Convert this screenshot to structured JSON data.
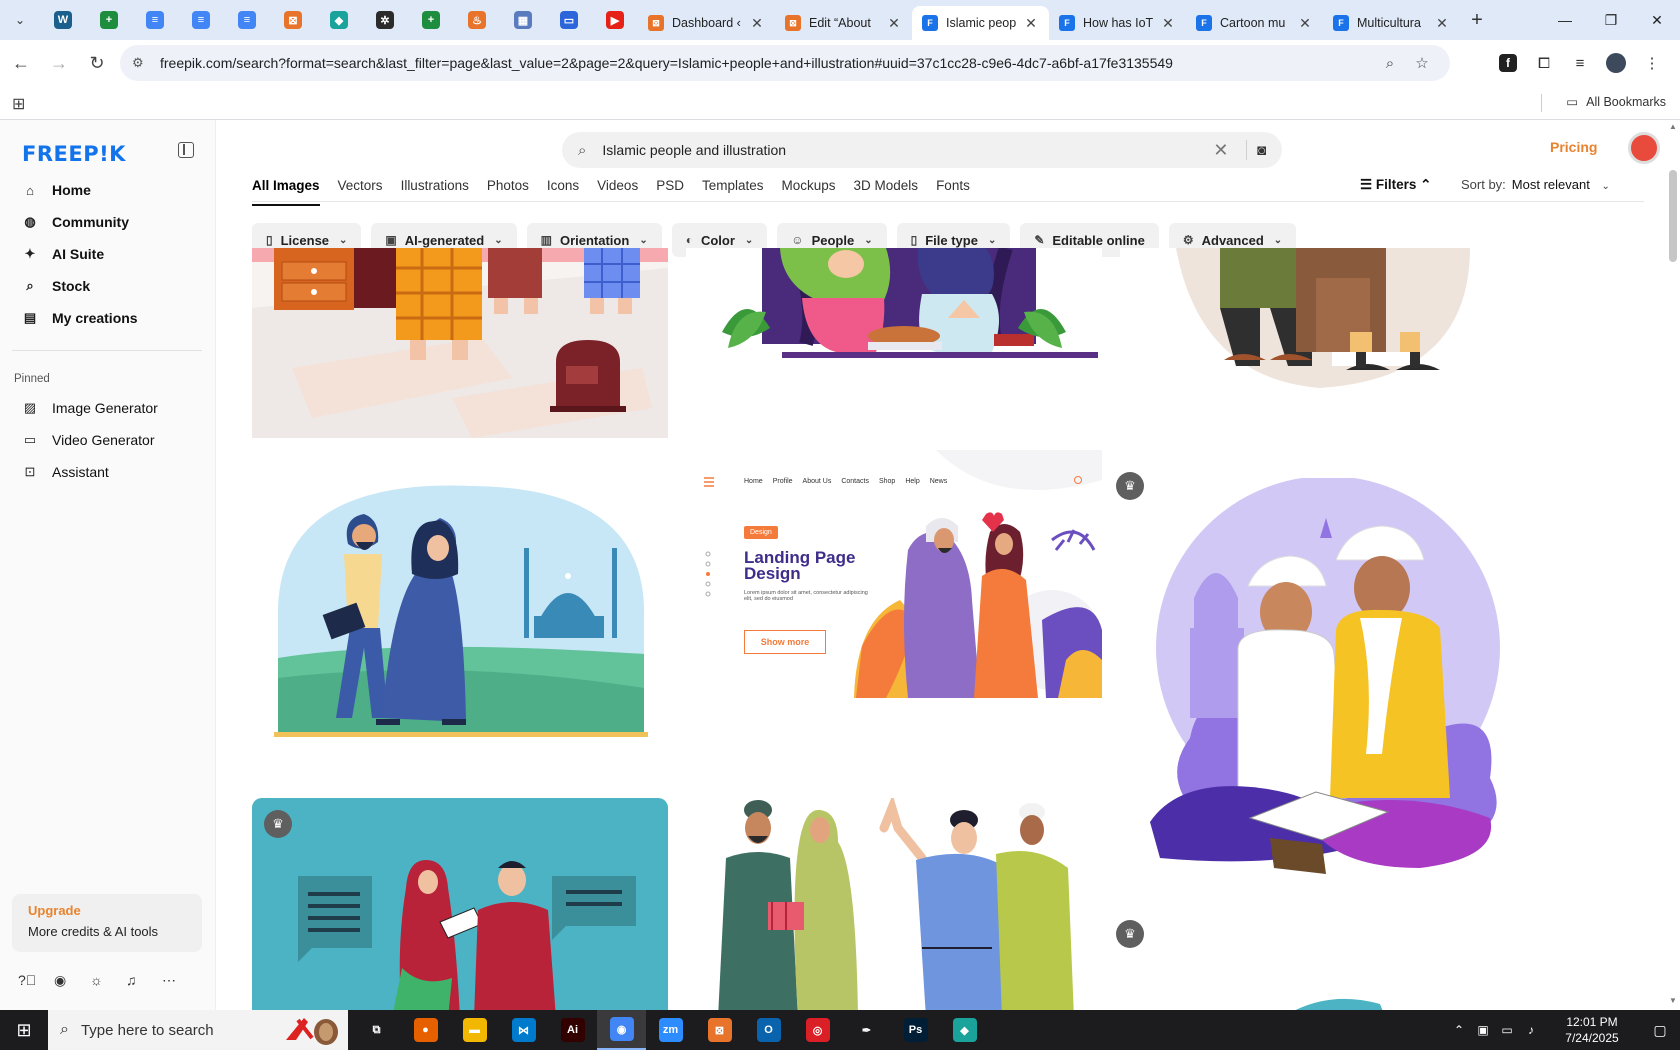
{
  "browser": {
    "pinned_tabs": [
      {
        "icon": "wordpress-icon",
        "color": "#1b5f8c",
        "glyph": "W"
      },
      {
        "icon": "sheets-icon",
        "color": "#1e8e3e",
        "glyph": "+"
      },
      {
        "icon": "docs-icon",
        "color": "#4285f4",
        "glyph": "≡"
      },
      {
        "icon": "docs-icon",
        "color": "#4285f4",
        "glyph": "≡"
      },
      {
        "icon": "docs-icon",
        "color": "#4285f4",
        "glyph": "≡"
      },
      {
        "icon": "xampp-icon",
        "color": "#e8742c",
        "glyph": "⊠"
      },
      {
        "icon": "app-icon",
        "color": "#1aa39a",
        "glyph": "◆"
      },
      {
        "icon": "chatgpt-icon",
        "color": "#2b2b2b",
        "glyph": "✲"
      },
      {
        "icon": "sheets-icon",
        "color": "#1e8e3e",
        "glyph": "+"
      },
      {
        "icon": "site-icon",
        "color": "#e8742c",
        "glyph": "♨"
      },
      {
        "icon": "app-icon",
        "color": "#5a7bbd",
        "glyph": "▦"
      },
      {
        "icon": "forms-icon",
        "color": "#2b65d9",
        "glyph": "▭"
      },
      {
        "icon": "youtube-icon",
        "color": "#e62117",
        "glyph": "▶"
      }
    ],
    "tabs": [
      {
        "title": "Dashboard ‹",
        "icon": "xampp-icon",
        "color": "#e8742c",
        "glyph": "⊠"
      },
      {
        "title": "Edit “About",
        "icon": "xampp-icon",
        "color": "#e8742c",
        "glyph": "⊠"
      },
      {
        "title": "Islamic peop",
        "icon": "docs-icon",
        "color": "#1a73e8",
        "glyph": "F",
        "active": true
      },
      {
        "title": "How has IoT",
        "icon": "docs-icon",
        "color": "#1a73e8",
        "glyph": "F"
      },
      {
        "title": "Cartoon mu",
        "icon": "docs-icon",
        "color": "#1a73e8",
        "glyph": "F"
      },
      {
        "title": "Multicultura",
        "icon": "docs-icon",
        "color": "#1a73e8",
        "glyph": "F"
      }
    ],
    "url": "freepik.com/search?format=search&last_filter=page&last_value=2&page=2&query=Islamic+people+and+illustration#uuid=37c1cc28-c9e6-4dc7-a6bf-a17fe3135549",
    "all_bookmarks": "All Bookmarks"
  },
  "sidebar": {
    "logo": "FREEP!K",
    "nav": [
      {
        "label": "Home",
        "icon": "home-icon",
        "glyph": "⌂"
      },
      {
        "label": "Community",
        "icon": "globe-icon",
        "glyph": "◍"
      },
      {
        "label": "AI Suite",
        "icon": "sparkle-icon",
        "glyph": "✦"
      },
      {
        "label": "Stock",
        "icon": "search-icon",
        "glyph": "⌕"
      },
      {
        "label": "My creations",
        "icon": "folder-icon",
        "glyph": "▤"
      }
    ],
    "pinned_heading": "Pinned",
    "pinned": [
      {
        "label": "Image Generator",
        "icon": "image-icon",
        "glyph": "▨"
      },
      {
        "label": "Video Generator",
        "icon": "video-icon",
        "glyph": "▭"
      },
      {
        "label": "Assistant",
        "icon": "assistant-icon",
        "glyph": "⊡"
      }
    ],
    "upgrade_title": "Upgrade",
    "upgrade_sub": "More credits & AI tools"
  },
  "header": {
    "search_value": "Islamic people and illustration",
    "pricing": "Pricing"
  },
  "category_tabs": [
    "All Images",
    "Vectors",
    "Illustrations",
    "Photos",
    "Icons",
    "Videos",
    "PSD",
    "Templates",
    "Mockups",
    "3D Models",
    "Fonts"
  ],
  "filters_label": "Filters",
  "sort": {
    "label": "Sort by:",
    "value": "Most relevant"
  },
  "chips": [
    {
      "label": "License",
      "icon": "license-icon",
      "glyph": "▯"
    },
    {
      "label": "AI-generated",
      "icon": "ai-icon",
      "glyph": "▣"
    },
    {
      "label": "Orientation",
      "icon": "orientation-icon",
      "glyph": "▥"
    },
    {
      "label": "Color",
      "icon": "palette-icon",
      "glyph": "◐"
    },
    {
      "label": "People",
      "icon": "people-icon",
      "glyph": "☺"
    },
    {
      "label": "File type",
      "icon": "file-icon",
      "glyph": "▯"
    },
    {
      "label": "Editable online",
      "icon": "pen-icon",
      "glyph": "✎",
      "no_caret": true
    },
    {
      "label": "Advanced",
      "icon": "gear-icon",
      "glyph": "⚙"
    }
  ],
  "landing_card": {
    "nav": [
      "Home",
      "Profile",
      "About Us",
      "Contacts",
      "Shop",
      "Help",
      "News"
    ],
    "tag": "Design",
    "title": "Landing Page Design",
    "sub": "Lorem ipsum dolor sit amet, consectetur adipiscing elit, sed do eiusmod",
    "button": "Show more"
  },
  "taskbar": {
    "search_placeholder": "Type here to search",
    "apps": [
      {
        "icon": "task-view-icon",
        "color": "transparent",
        "glyph": "⧉"
      },
      {
        "icon": "firefox-icon",
        "color": "#e66000",
        "glyph": "●"
      },
      {
        "icon": "file-explorer-icon",
        "color": "#f2b800",
        "glyph": "▬"
      },
      {
        "icon": "vscode-icon",
        "color": "#007acc",
        "glyph": "⋈"
      },
      {
        "icon": "illustrator-icon",
        "color": "#330000",
        "glyph": "Ai"
      },
      {
        "icon": "chrome-icon",
        "color": "#4285f4",
        "glyph": "◉",
        "active": true
      },
      {
        "icon": "zoom-icon",
        "color": "#2d8cff",
        "glyph": "zm"
      },
      {
        "icon": "xampp-icon",
        "color": "#e8742c",
        "glyph": "⊠"
      },
      {
        "icon": "outlook-icon",
        "color": "#0a64ad",
        "glyph": "O"
      },
      {
        "icon": "creative-cloud-icon",
        "color": "#da1f26",
        "glyph": "◎"
      },
      {
        "icon": "pen-tool-icon",
        "color": "transparent",
        "glyph": "✒"
      },
      {
        "icon": "photoshop-icon",
        "color": "#001e36",
        "glyph": "Ps"
      },
      {
        "icon": "app-icon",
        "color": "#1aa39a",
        "glyph": "◆"
      }
    ],
    "time": "12:01 PM",
    "date": "7/24/2025"
  }
}
